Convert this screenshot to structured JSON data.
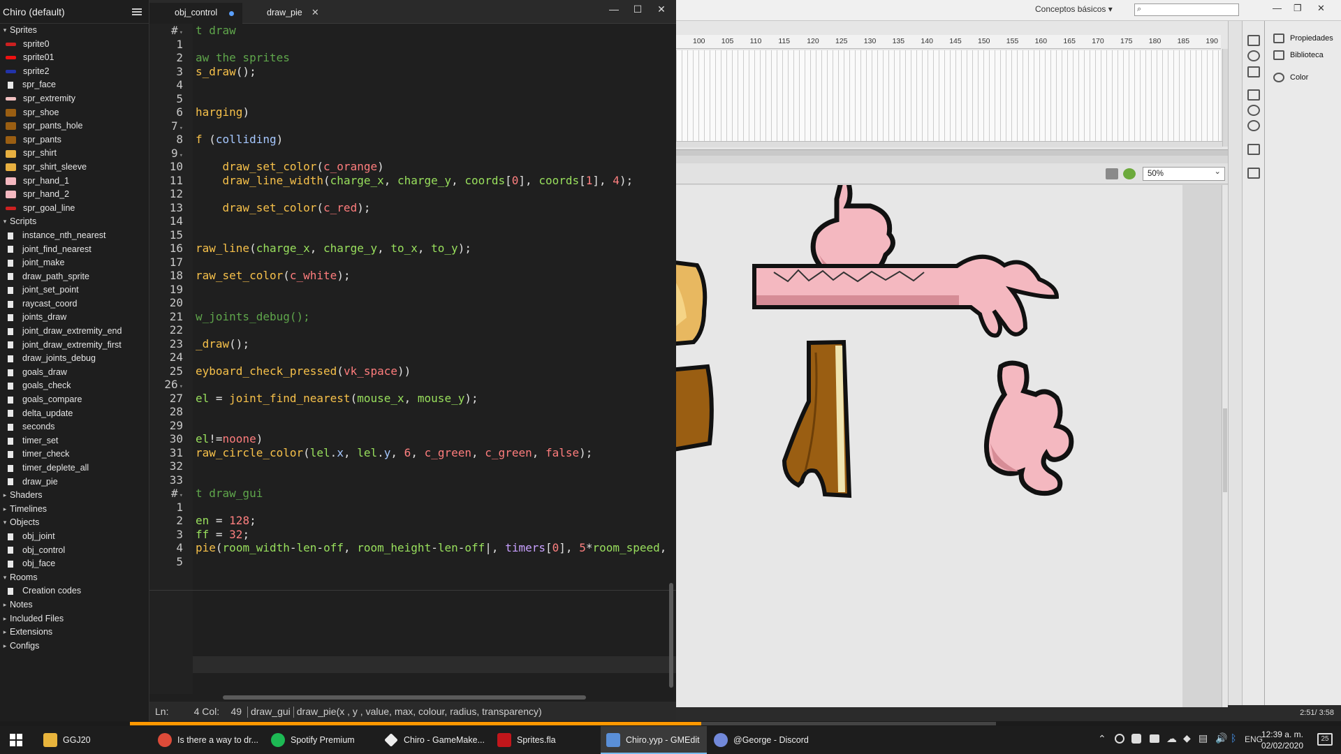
{
  "tree": {
    "title": "Chiro (default)",
    "groups": [
      {
        "label": "Sprites",
        "items": [
          "sprite0",
          "sprite01",
          "sprite2",
          "spr_face",
          "spr_extremity",
          "spr_shoe",
          "spr_pants_hole",
          "spr_pants",
          "spr_shirt",
          "spr_shirt_sleeve",
          "spr_hand_1",
          "spr_hand_2",
          "spr_goal_line"
        ]
      },
      {
        "label": "Scripts",
        "items": [
          "instance_nth_nearest",
          "joint_find_nearest",
          "joint_make",
          "draw_path_sprite",
          "joint_set_point",
          "raycast_coord",
          "joints_draw",
          "joint_draw_extremity_end",
          "joint_draw_extremity_first",
          "draw_joints_debug",
          "goals_draw",
          "goals_check",
          "goals_compare",
          "delta_update",
          "seconds",
          "timer_set",
          "timer_check",
          "timer_deplete_all",
          "draw_pie"
        ]
      },
      {
        "label": "Shaders",
        "items": []
      },
      {
        "label": "Timelines",
        "items": []
      },
      {
        "label": "Objects",
        "items": [
          "obj_joint",
          "obj_control",
          "obj_face"
        ]
      },
      {
        "label": "Rooms",
        "items": [
          "Creation codes"
        ]
      },
      {
        "label": "Notes",
        "items": []
      },
      {
        "label": "Included Files",
        "items": []
      },
      {
        "label": "Extensions",
        "items": []
      },
      {
        "label": "Configs",
        "items": []
      }
    ]
  },
  "editor": {
    "tabs": [
      {
        "label": "obj_control",
        "modified": true
      },
      {
        "label": "draw_pie",
        "modified": false
      }
    ],
    "window_buttons": [
      "—",
      "☐",
      "✕"
    ],
    "status": {
      "ln_label": "Ln:",
      "ln": "4",
      "col_label": "Col:",
      "col": "49",
      "event": "draw_gui",
      "signature": "draw_pie(x , y , value, max, colour, radius, transparency)"
    }
  },
  "animate": {
    "workspace": "Conceptos básicos",
    "search_placeholder": "",
    "ruler": [
      "100",
      "105",
      "110",
      "115",
      "120",
      "125",
      "130",
      "135",
      "140",
      "145",
      "150",
      "155",
      "160",
      "165",
      "170",
      "175",
      "180",
      "185",
      "190"
    ],
    "zoom": "50%",
    "panels": [
      "Propiedades",
      "Biblioteca",
      "Color"
    ],
    "timecode": "2:51/ 3:58"
  },
  "taskbar": {
    "items": [
      "GGJ20",
      "Is there a way to dr...",
      "Spotify Premium",
      "Chiro - GameMake...",
      "Sprites.fla",
      "Chiro.yyp - GMEdit",
      "@George - Discord"
    ],
    "lang": "ENG",
    "time": "12:39 a. m.",
    "date": "02/02/2020",
    "notif_count": "25",
    "progress": 0.66
  },
  "colors": {
    "accent": "#5aa0ff",
    "progress": "#ff9800",
    "skin": "#f4b8c0"
  }
}
